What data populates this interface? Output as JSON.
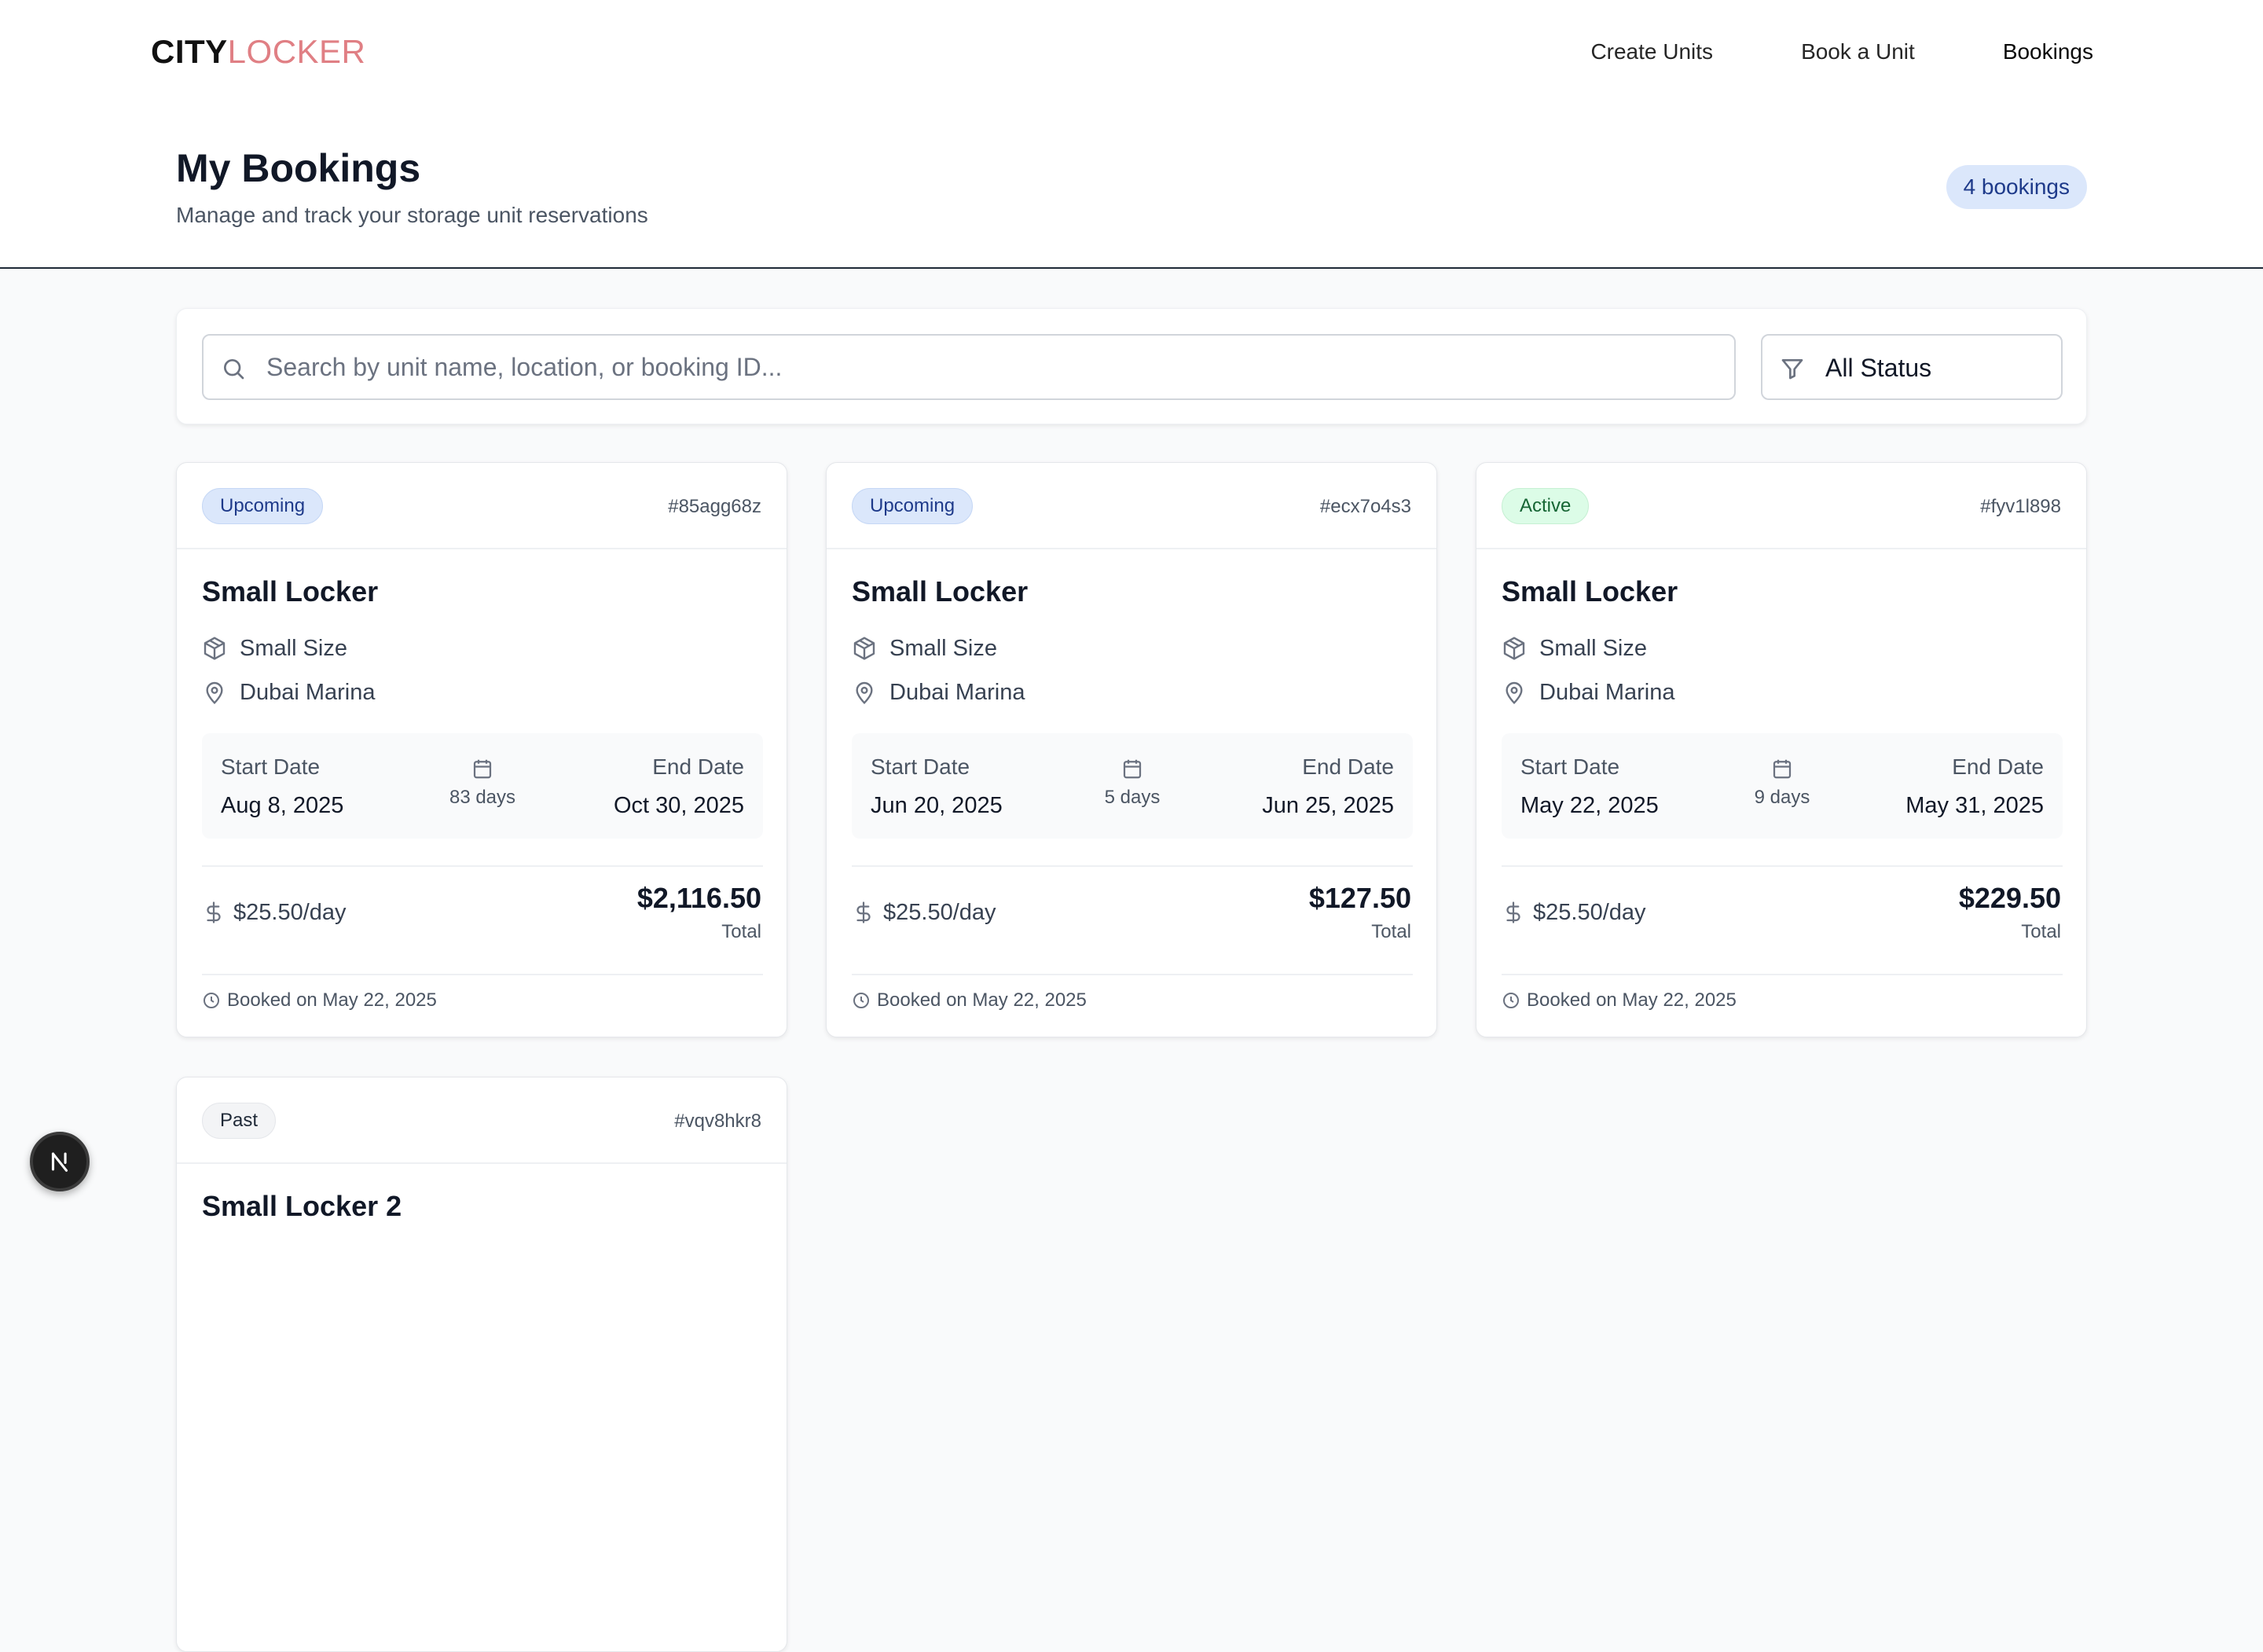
{
  "brand": {
    "part1": "CITY",
    "part2": "LOCKER"
  },
  "nav": {
    "items": [
      {
        "label": "Create Units"
      },
      {
        "label": "Book a Unit"
      },
      {
        "label": "Bookings"
      }
    ]
  },
  "header": {
    "title": "My Bookings",
    "subtitle": "Manage and track your storage unit reservations",
    "count_badge": "4 bookings"
  },
  "filters": {
    "search_placeholder": "Search by unit name, location, or booking ID...",
    "search_value": "",
    "status_selected": "All Status",
    "icons": {
      "search": "search-icon",
      "filter": "filter-icon"
    }
  },
  "cards": [
    {
      "status": "Upcoming",
      "id": "#85agg68z",
      "name": "Small Locker",
      "size": "Small Size",
      "location": "Dubai Marina",
      "start_label": "Start Date",
      "start_date": "Aug 8, 2025",
      "duration": "83 days",
      "end_label": "End Date",
      "end_date": "Oct 30, 2025",
      "rate": "$25.50/day",
      "total": "$2,116.50",
      "total_label": "Total",
      "booked_on": "Booked on May 22, 2025"
    },
    {
      "status": "Upcoming",
      "id": "#ecx7o4s3",
      "name": "Small Locker",
      "size": "Small Size",
      "location": "Dubai Marina",
      "start_label": "Start Date",
      "start_date": "Jun 20, 2025",
      "duration": "5 days",
      "end_label": "End Date",
      "end_date": "Jun 25, 2025",
      "rate": "$25.50/day",
      "total": "$127.50",
      "total_label": "Total",
      "booked_on": "Booked on May 22, 2025"
    },
    {
      "status": "Active",
      "id": "#fyv1l898",
      "name": "Small Locker",
      "size": "Small Size",
      "location": "Dubai Marina",
      "start_label": "Start Date",
      "start_date": "May 22, 2025",
      "duration": "9 days",
      "end_label": "End Date",
      "end_date": "May 31, 2025",
      "rate": "$25.50/day",
      "total": "$229.50",
      "total_label": "Total",
      "booked_on": "Booked on May 22, 2025"
    },
    {
      "status": "Past",
      "id": "#vqv8hkr8",
      "name": "Small Locker 2"
    }
  ],
  "floating_badge": {
    "letter": "N"
  },
  "colors": {
    "brand_accent": "#e07f84",
    "upcoming_bg": "#dbe7fb",
    "active_bg": "#dcfce7",
    "past_bg": "#f3f4f6",
    "page_bg": "#f9fafb"
  }
}
